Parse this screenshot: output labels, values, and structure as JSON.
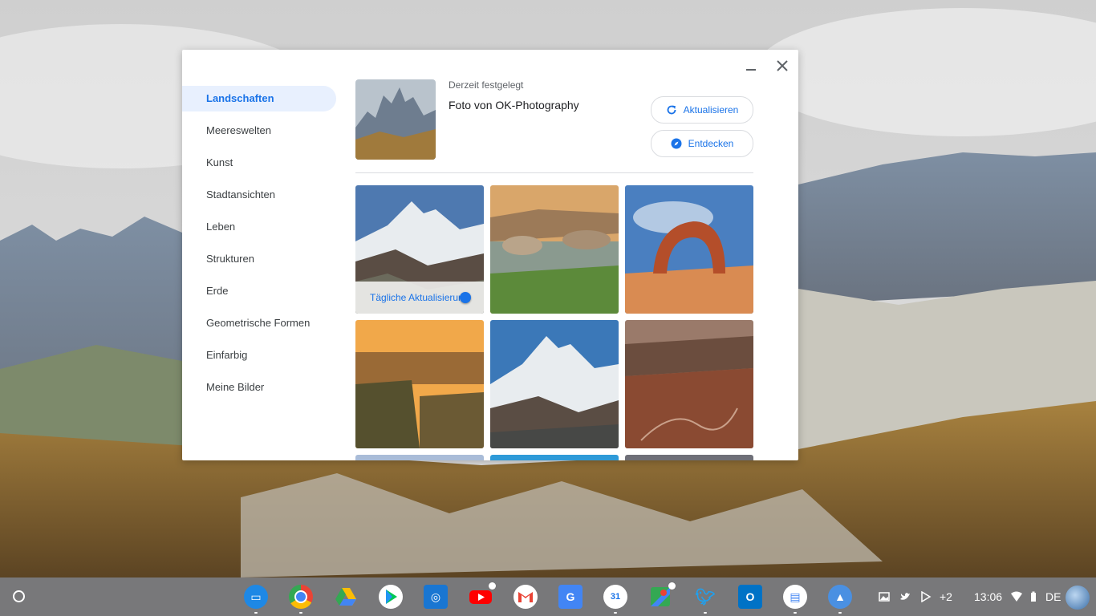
{
  "window": {
    "sidebar": [
      {
        "label": "Landschaften",
        "active": true
      },
      {
        "label": "Meereswelten",
        "active": false
      },
      {
        "label": "Kunst",
        "active": false
      },
      {
        "label": "Stadtansichten",
        "active": false
      },
      {
        "label": "Leben",
        "active": false
      },
      {
        "label": "Strukturen",
        "active": false
      },
      {
        "label": "Erde",
        "active": false
      },
      {
        "label": "Geometrische Formen",
        "active": false
      },
      {
        "label": "Einfarbig",
        "active": false
      },
      {
        "label": "Meine Bilder",
        "active": false
      }
    ],
    "current": {
      "label": "Derzeit festgelegt",
      "name": "Foto von OK-Photography"
    },
    "buttons": {
      "refresh": "Aktualisieren",
      "explore": "Entdecken"
    },
    "daily_refresh_label": "Tägliche Aktualisierung"
  },
  "shelf": {
    "apps": [
      "files",
      "chrome",
      "drive",
      "play-store",
      "remote-desktop",
      "youtube",
      "gmail",
      "translate",
      "calendar",
      "maps",
      "twitter",
      "outlook",
      "web-store",
      "wallpaper"
    ],
    "tray": {
      "extra_count": "+2",
      "time": "13:06",
      "keyboard": "DE"
    }
  },
  "colors": {
    "accent": "#1a73e8",
    "active_bg": "#e8f0fe"
  }
}
